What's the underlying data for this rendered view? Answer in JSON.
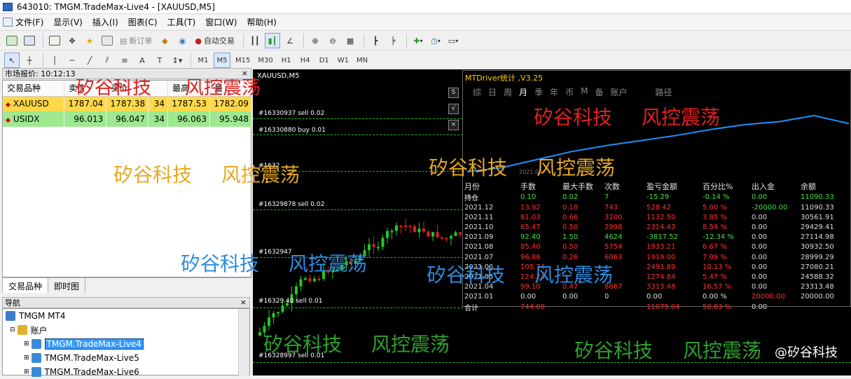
{
  "window": {
    "title": "643010: TMGM.TradeMax-Live4 - [XAUUSD,M5]"
  },
  "menu": [
    "文件(F)",
    "显示(V)",
    "插入(I)",
    "图表(C)",
    "工具(T)",
    "窗口(W)",
    "帮助(H)"
  ],
  "toolbar": {
    "new_order": "新订单",
    "auto_trading": "自动交易"
  },
  "timeframes": [
    "M1",
    "M5",
    "M15",
    "M30",
    "H1",
    "H4",
    "D1",
    "W1",
    "MN"
  ],
  "timeframe_selected": "M5",
  "market_watch": {
    "title": "市场报价: 10:12:13",
    "columns": [
      "交易品种",
      "卖价",
      "买价",
      "",
      "最高",
      "最"
    ],
    "rows": [
      {
        "symbol": "XAUUSD",
        "bid": "1787.04",
        "ask": "1787.38",
        "spread": "34",
        "high": "1787.53",
        "low": "1782.09"
      },
      {
        "symbol": "USIDX",
        "bid": "96.013",
        "ask": "96.047",
        "spread": "34",
        "high": "96.063",
        "low": "95.948"
      }
    ],
    "tabs": [
      "交易品种",
      "即时图"
    ]
  },
  "navigator": {
    "title": "导航",
    "root": "TMGM MT4",
    "accounts": "账户",
    "items": [
      "TMGM.TradeMax-Live4",
      "TMGM.TradeMax-Live5",
      "TMGM.TradeMax-Live6"
    ]
  },
  "chart": {
    "symbol_label": "XAUUSD,M5",
    "orders": [
      "#16330937 sell 0.02",
      "#16330880 buy 0.01",
      "#1632",
      "#16329878 sell 0.02",
      "#1632947",
      "#16329.40 sell 0.01",
      "#16328997 sell 0.01"
    ]
  },
  "stats": {
    "title": "MTDriver统计 ,V3.25",
    "tabs": [
      "综",
      "日",
      "周",
      "月",
      "季",
      "年",
      "币",
      "M",
      "备",
      "账户",
      "路径"
    ],
    "active_tab": "月",
    "headers": [
      "月份",
      "手数",
      "最大手数",
      "次数",
      "盈亏金额",
      "百分比%",
      "出入金",
      "余额"
    ],
    "rows": [
      [
        "持仓",
        "0.10",
        "0.02",
        "7",
        "-15.29",
        "-0.14 %",
        "0.00",
        "11090.33"
      ],
      [
        "2021.12",
        "13.92",
        "0.18",
        "743",
        "528.42",
        "5.00 %",
        "-20000.00",
        "11090.33"
      ],
      [
        "2021.11",
        "81.03",
        "0.66",
        "3200",
        "1132.50",
        "3.85 %",
        "0.00",
        "30561.91"
      ],
      [
        "2021.10",
        "65.47",
        "0.50",
        "2998",
        "2314.43",
        "8.54 %",
        "0.00",
        "29429.41"
      ],
      [
        "2021.09",
        "92.40",
        "1.50",
        "4624",
        "-3817.52",
        "-12.34 %",
        "0.00",
        "27114.98"
      ],
      [
        "2021.08",
        "85.40",
        "0.50",
        "5754",
        "1933.21",
        "6.67 %",
        "0.00",
        "30932.50"
      ],
      [
        "2021.07",
        "96.86",
        "0.26",
        "6063",
        "1919.00",
        "7.09 %",
        "0.00",
        "28999.29"
      ],
      [
        "2021.06",
        "105.74",
        "",
        "",
        "2491.89",
        "10.13 %",
        "0.00",
        "27080.21"
      ],
      [
        "2021.05",
        "124.24",
        "",
        "",
        "1274.84",
        "5.47 %",
        "0.00",
        "24588.32"
      ],
      [
        "2021.04",
        "99.10",
        "0.47",
        "8667",
        "3313.48",
        "16.57 %",
        "0.00",
        "23313.48"
      ],
      [
        "2021.01",
        "0.00",
        "0.00",
        "0",
        "0.00",
        "0.00 %",
        "20000.00",
        "20000.00"
      ],
      [
        "合计",
        "744.08",
        "",
        "",
        "11075.04",
        "50.83 %",
        "0.00",
        ""
      ]
    ],
    "equity_line": [
      10,
      14,
      22,
      30,
      36,
      41,
      46,
      52,
      57,
      60,
      66,
      58
    ],
    "small_label": "2021.04"
  },
  "watermarks": {
    "a": "矽谷科技",
    "b": "风控震荡",
    "brand": "@矽谷科技"
  },
  "colors": {
    "gold_row": "#ffd84a",
    "green_row": "#9ee890",
    "bull": "#22c822",
    "bear": "#e02020",
    "equity": "#1e90ff"
  }
}
